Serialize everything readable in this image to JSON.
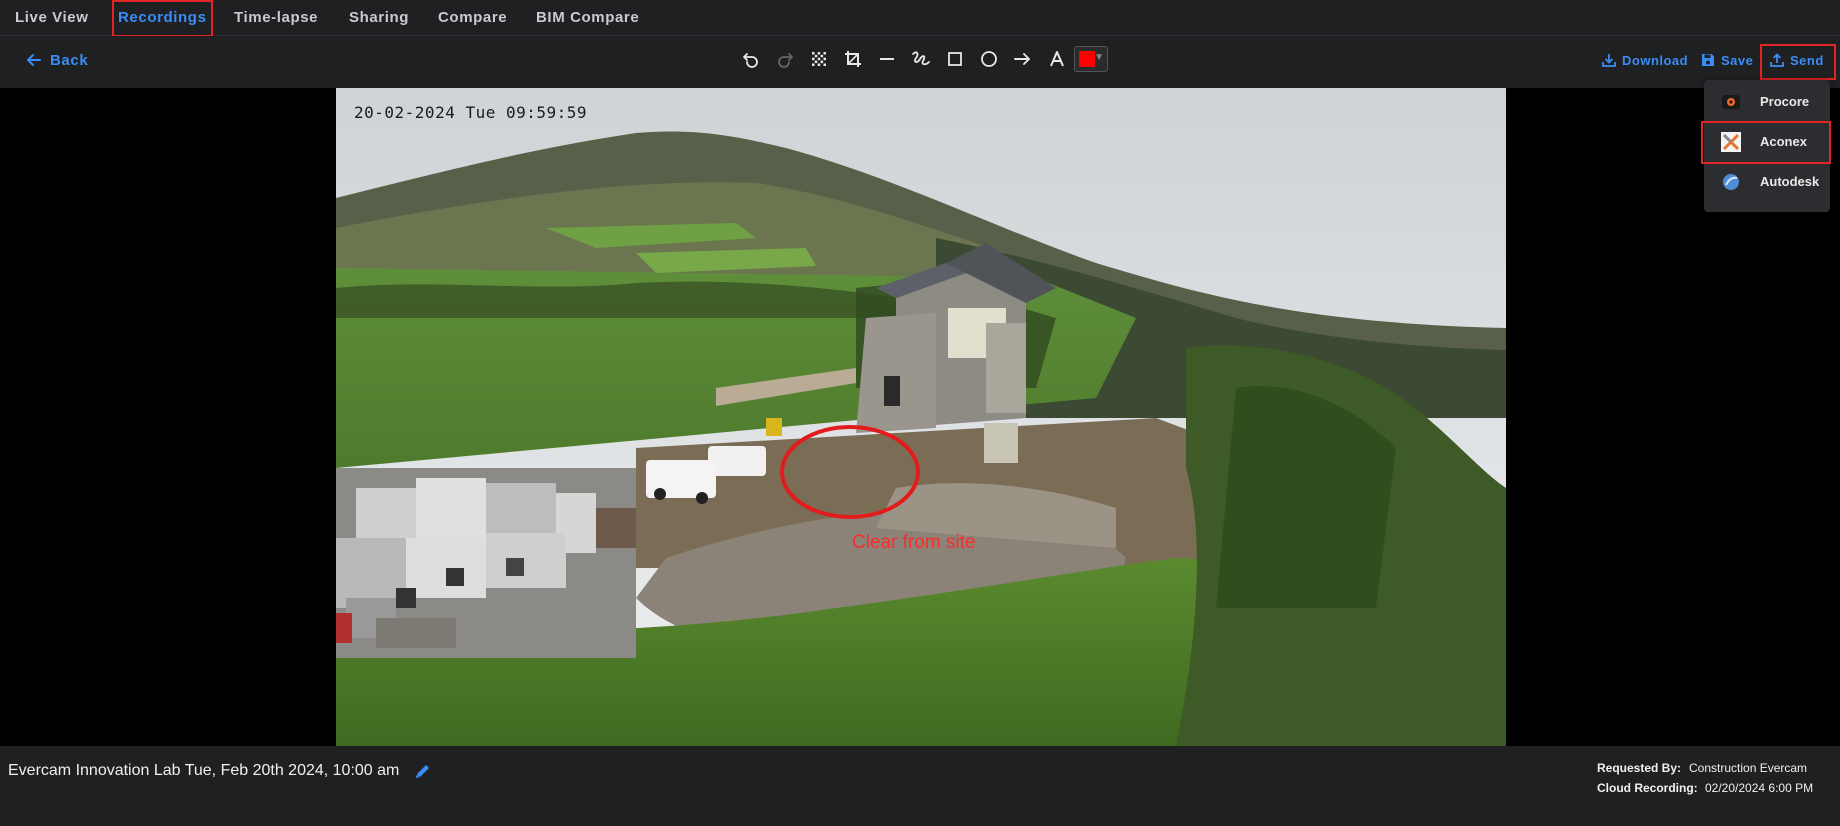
{
  "tabs": [
    {
      "label": "Live View",
      "active": false
    },
    {
      "label": "Recordings",
      "active": true
    },
    {
      "label": "Time-lapse",
      "active": false
    },
    {
      "label": "Sharing",
      "active": false
    },
    {
      "label": "Compare",
      "active": false
    },
    {
      "label": "BIM Compare",
      "active": false
    }
  ],
  "toolbar": {
    "back_label": "Back",
    "tools": [
      "undo-icon",
      "redo-icon",
      "pixelate-icon",
      "crop-icon",
      "line-icon",
      "freehand-icon",
      "rectangle-icon",
      "ellipse-icon",
      "arrow-icon",
      "text-icon"
    ],
    "selected_color": "#ff0000",
    "download_label": "Download",
    "save_label": "Save",
    "send_label": "Send"
  },
  "send_menu": {
    "items": [
      {
        "label": "Procore",
        "icon": "procore-icon"
      },
      {
        "label": "Aconex",
        "icon": "aconex-icon"
      },
      {
        "label": "Autodesk",
        "icon": "autodesk-icon"
      }
    ]
  },
  "snapshot": {
    "timestamp": "20-02-2024 Tue 09:59:59",
    "annotation_text": "Clear from site"
  },
  "footer": {
    "title": "Evercam Innovation Lab Tue, Feb 20th 2024, 10:00 am",
    "requested_by_label": "Requested By:",
    "requested_by_value": "Construction Evercam",
    "cloud_recording_label": "Cloud Recording:",
    "cloud_recording_value": "02/20/2024 6:00 PM"
  },
  "colors": {
    "accent": "#3a8df6",
    "highlight": "#e22424",
    "bar": "#1f2022"
  }
}
